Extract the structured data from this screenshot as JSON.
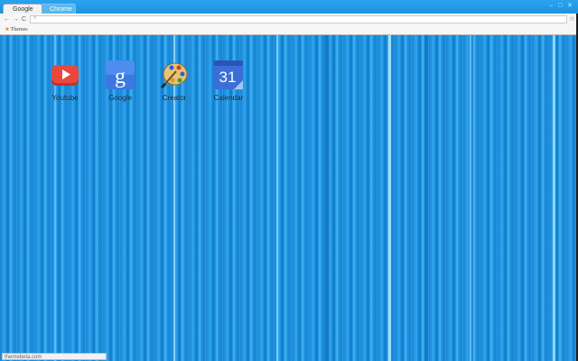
{
  "tabs": [
    {
      "label": "Google"
    },
    {
      "label": "Chrome"
    }
  ],
  "window_controls": "– □ ✕",
  "toolbar": {
    "back_icon": "←",
    "forward_icon": "→",
    "reload_icon": "C",
    "search_icon": "⌕",
    "star_icon": "☆"
  },
  "bookmarks": [
    {
      "label": "Themes"
    }
  ],
  "apps": [
    {
      "label": "Youtube",
      "icon": "youtube-icon"
    },
    {
      "label": "Google",
      "icon": "google-icon"
    },
    {
      "label": "Creator",
      "icon": "palette-icon"
    },
    {
      "label": "Calendar",
      "icon": "calendar-icon",
      "date": "31"
    }
  ],
  "google_letter": "g",
  "status_text": "themebeta.com"
}
